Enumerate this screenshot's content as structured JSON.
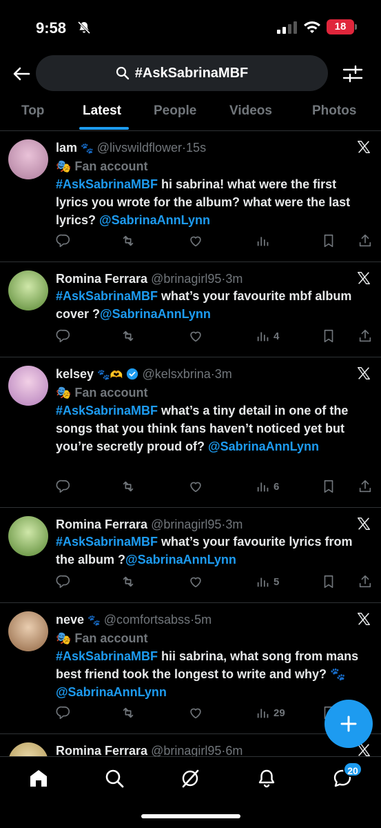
{
  "status": {
    "time": "9:58",
    "battery": "18"
  },
  "search": {
    "query": "#AskSabrinaMBF"
  },
  "tabs": [
    "Top",
    "Latest",
    "People",
    "Videos",
    "Photos"
  ],
  "posts": [
    {
      "name": "lam",
      "name_emoji": "🐾",
      "handle": "@livswildflower",
      "dot": "·",
      "ago": "15s",
      "fan": "Fan account",
      "segments": [
        {
          "t": "#AskSabrinaMBF",
          "k": "tag"
        },
        {
          "t": " hi sabrina! what were the first lyrics you wrote for the album? what were the last lyrics? ",
          "k": "text"
        },
        {
          "t": "@SabrinaAnnLynn",
          "k": "mention"
        }
      ],
      "views": ""
    },
    {
      "name": "Romina Ferrara",
      "name_emoji": "",
      "handle": "@brinagirl95",
      "dot": "·",
      "ago": "3m",
      "fan": "",
      "segments": [
        {
          "t": "#AskSabrinaMBF",
          "k": "tag"
        },
        {
          "t": " what’s your favourite mbf album cover ?",
          "k": "text"
        },
        {
          "t": "@SabrinaAnnLynn",
          "k": "mention"
        }
      ],
      "views": "4"
    },
    {
      "name": "kelsey",
      "name_emoji": "🐾🫶",
      "handle": "@kelsxbrina",
      "dot": "·",
      "ago": "3m",
      "fan": "Fan account",
      "segments": [
        {
          "t": "#AskSabrinaMBF",
          "k": "tag"
        },
        {
          "t": " what’s a tiny detail in one of the songs that you think fans haven’t noticed yet but you’re secretly proud of? ",
          "k": "text"
        },
        {
          "t": "@SabrinaAnnLynn",
          "k": "mention"
        }
      ],
      "views": "6"
    },
    {
      "name": "Romina Ferrara",
      "name_emoji": "",
      "handle": "@brinagirl95",
      "dot": "·",
      "ago": "3m",
      "fan": "",
      "segments": [
        {
          "t": "#AskSabrinaMBF",
          "k": "tag"
        },
        {
          "t": " what’s your favourite lyrics from the album ?",
          "k": "text"
        },
        {
          "t": "@SabrinaAnnLynn",
          "k": "mention"
        }
      ],
      "views": "5"
    },
    {
      "name": "neve",
      "name_emoji": "🐾",
      "handle": "@comfortsabss",
      "dot": "·",
      "ago": "5m",
      "fan": "Fan account",
      "segments": [
        {
          "t": "#AskSabrinaMBF",
          "k": "tag"
        },
        {
          "t": " hii sabrina, what song from mans best friend took the longest to write and why? 🐾 ",
          "k": "text"
        },
        {
          "t": "@SabrinaAnnLynn",
          "k": "mention"
        }
      ],
      "views": "29"
    },
    {
      "name": "Romina Ferrara",
      "name_emoji": "",
      "handle": "@brinagirl95",
      "dot": "·",
      "ago": "6m",
      "fan": "",
      "segments": [],
      "views": ""
    }
  ],
  "nav": {
    "messages_badge": "20"
  },
  "colors": {
    "accent": "#1d9bf0",
    "background": "#000000",
    "muted": "#71767b"
  }
}
